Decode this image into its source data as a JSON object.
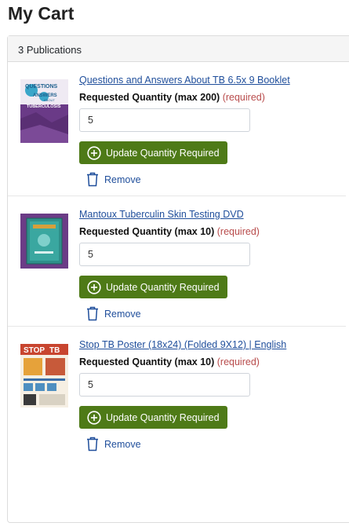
{
  "page": {
    "title": "My Cart"
  },
  "cart": {
    "count_label": "3 Publications",
    "items": [
      {
        "title": "Questions and Answers About TB 6.5x 9 Booklet",
        "qty_label": "Requested Quantity (max 200)",
        "required_label": "(required)",
        "qty_value": "5",
        "update_label": "Update Quantity Required",
        "remove_label": "Remove",
        "thumb_text": [
          "QUESTIONS",
          "ANSWERS",
          "ABOUT",
          "TUBERCULOSIS"
        ]
      },
      {
        "title": "Mantoux Tuberculin Skin Testing DVD",
        "qty_label": "Requested Quantity (max 10)",
        "required_label": "(required)",
        "qty_value": "5",
        "update_label": "Update Quantity Required",
        "remove_label": "Remove"
      },
      {
        "title": "Stop TB Poster (18x24) (Folded 9X12) | English",
        "qty_label": "Requested Quantity (max 10)",
        "required_label": "(required)",
        "qty_value": "5",
        "update_label": "Update Quantity Required",
        "remove_label": "Remove",
        "thumb_text": [
          "STOP",
          "TB"
        ]
      }
    ]
  },
  "colors": {
    "update_button": "#4e7a17",
    "link": "#1f4e9b",
    "required": "#b84b4b"
  },
  "icons": {
    "update": "plus-circle-icon",
    "remove": "trash-icon"
  }
}
